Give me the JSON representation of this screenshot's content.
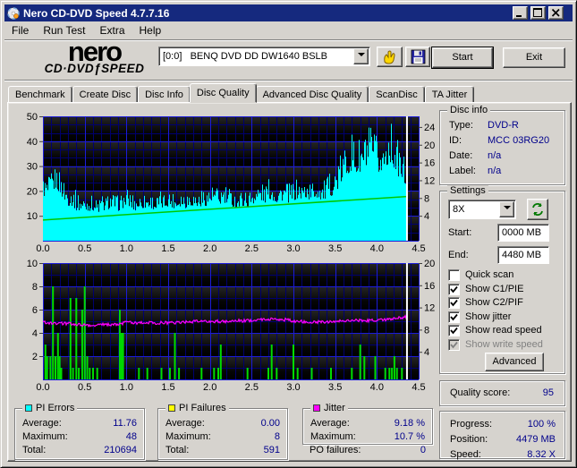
{
  "window": {
    "title": "Nero CD-DVD Speed 4.7.7.16"
  },
  "menu": {
    "items": [
      "File",
      "Run Test",
      "Extra",
      "Help"
    ]
  },
  "toolbar": {
    "logo_line1": "nero",
    "logo_line2": "CD·DVDƒSPEED",
    "drive_select": "[0:0]   BENQ DVD DD DW1640 BSLB",
    "start_label": "Start",
    "exit_label": "Exit"
  },
  "tabs": [
    {
      "label": "Benchmark",
      "active": false
    },
    {
      "label": "Create Disc",
      "active": false
    },
    {
      "label": "Disc Info",
      "active": false
    },
    {
      "label": "Disc Quality",
      "active": true
    },
    {
      "label": "Advanced Disc Quality",
      "active": false
    },
    {
      "label": "ScanDisc",
      "active": false
    },
    {
      "label": "TA Jitter",
      "active": false
    }
  ],
  "disc_info": {
    "title": "Disc info",
    "rows": [
      {
        "label": "Type:",
        "value": "DVD-R"
      },
      {
        "label": "ID:",
        "value": "MCC 03RG20"
      },
      {
        "label": "Date:",
        "value": "n/a"
      },
      {
        "label": "Label:",
        "value": "n/a"
      }
    ]
  },
  "settings": {
    "title": "Settings",
    "speed_value": "8X",
    "start_label": "Start:",
    "start_value": "0000 MB",
    "end_label": "End:",
    "end_value": "4480 MB",
    "checkboxes": [
      {
        "label": "Quick scan",
        "checked": false,
        "disabled": false
      },
      {
        "label": "Show C1/PIE",
        "checked": true,
        "disabled": false
      },
      {
        "label": "Show C2/PIF",
        "checked": true,
        "disabled": false
      },
      {
        "label": "Show jitter",
        "checked": true,
        "disabled": false
      },
      {
        "label": "Show read speed",
        "checked": true,
        "disabled": false
      },
      {
        "label": "Show write speed",
        "checked": true,
        "disabled": true
      }
    ],
    "advanced_label": "Advanced"
  },
  "quality": {
    "label": "Quality score:",
    "value": "95"
  },
  "progress": {
    "rows": [
      {
        "label": "Progress:",
        "value": "100 %"
      },
      {
        "label": "Position:",
        "value": "4479 MB"
      },
      {
        "label": "Speed:",
        "value": "8.32 X"
      }
    ]
  },
  "stats": [
    {
      "title": "PI Errors",
      "color": "#00ffff",
      "rows": [
        {
          "label": "Average:",
          "value": "11.76"
        },
        {
          "label": "Maximum:",
          "value": "48"
        },
        {
          "label": "Total:",
          "value": "210694"
        }
      ]
    },
    {
      "title": "PI Failures",
      "color": "#ffff00",
      "rows": [
        {
          "label": "Average:",
          "value": "0.00"
        },
        {
          "label": "Maximum:",
          "value": "8"
        },
        {
          "label": "Total:",
          "value": "591"
        }
      ]
    },
    {
      "title": "Jitter",
      "color": "#ff00ff",
      "rows": [
        {
          "label": "Average:",
          "value": "9.18 %"
        },
        {
          "label": "Maximum:",
          "value": "10.7 %"
        }
      ]
    }
  ],
  "po_failures": {
    "label": "PO failures:",
    "value": "0"
  },
  "chart_data": [
    {
      "type": "area",
      "name": "pi-errors-scan",
      "x_axis": {
        "min": 0,
        "max": 4.5,
        "major_step": 0.5,
        "minor_step": 0.1,
        "ticks": [
          "0.0",
          "0.5",
          "1.0",
          "1.5",
          "2.0",
          "2.5",
          "3.0",
          "3.5",
          "4.0",
          "4.5"
        ]
      },
      "y_left": {
        "min": 0,
        "max": 50,
        "ticks": [
          50,
          40,
          30,
          20,
          10
        ],
        "major_step": 10,
        "minor_per_major": 3
      },
      "y_right": {
        "min": 0,
        "max": 26.4,
        "ticks": [
          24,
          20,
          16,
          12,
          8,
          4
        ],
        "baseline_offset": 8
      },
      "data_end_x": 4.36,
      "cursor_color": "#ffffff",
      "series": [
        {
          "name": "pi_errors",
          "color": "#00ffff",
          "axis": "left",
          "sample_step": 0.05,
          "spike_bias": 1.6,
          "envelope_high": [
            26,
            25,
            28,
            30,
            28,
            25,
            22,
            22,
            20,
            19,
            18,
            19,
            18,
            17,
            19,
            18,
            20,
            19,
            18,
            19,
            21,
            20,
            18,
            19,
            19,
            20,
            19,
            18,
            20,
            19,
            21,
            20,
            19,
            21,
            20,
            21,
            20,
            20,
            21,
            21,
            22,
            23,
            21,
            23,
            22,
            21,
            20,
            20,
            21,
            20,
            22,
            23,
            24,
            23,
            25,
            24,
            23,
            24,
            24,
            23,
            24,
            25,
            24,
            25,
            24,
            25,
            25,
            24,
            26,
            28,
            30,
            34,
            38,
            43,
            44,
            40,
            42,
            44,
            46,
            45,
            42,
            40,
            45,
            49,
            44,
            40,
            36,
            32
          ],
          "envelope_low": [
            18,
            17,
            19,
            21,
            19,
            16,
            14,
            14,
            12,
            12,
            12,
            12,
            12,
            11,
            12,
            12,
            13,
            13,
            12,
            13,
            14,
            13,
            12,
            13,
            13,
            13,
            13,
            12,
            13,
            13,
            14,
            13,
            13,
            14,
            13,
            14,
            14,
            13,
            14,
            14,
            15,
            15,
            14,
            15,
            14,
            14,
            13,
            13,
            14,
            13,
            15,
            15,
            16,
            15,
            17,
            16,
            15,
            16,
            16,
            15,
            16,
            17,
            16,
            17,
            16,
            17,
            17,
            16,
            17,
            18,
            19,
            22,
            24,
            27,
            28,
            26,
            27,
            28,
            30,
            29,
            27,
            26,
            29,
            32,
            29,
            26,
            24,
            22
          ]
        },
        {
          "name": "read_speed",
          "color": "#00c800",
          "axis": "right",
          "points": [
            [
              0,
              3.05
            ],
            [
              4.36,
              8.35
            ]
          ]
        }
      ]
    },
    {
      "type": "spikes_line",
      "name": "pi-failures-jitter",
      "x_axis": {
        "min": 0,
        "max": 4.5,
        "major_step": 0.5,
        "minor_step": 0.1,
        "ticks": [
          "0.0",
          "0.5",
          "1.0",
          "1.5",
          "2.0",
          "2.5",
          "3.0",
          "3.5",
          "4.0",
          "4.5"
        ]
      },
      "y_left": {
        "min": 0,
        "max": 10,
        "ticks": [
          10,
          8,
          6,
          4,
          2
        ],
        "major_step": 2,
        "minor_per_major": 2
      },
      "y_right": {
        "min": 0,
        "max": 20,
        "ticks": [
          20,
          16,
          12,
          8,
          4
        ],
        "baseline_offset": 6
      },
      "data_end_x": 4.36,
      "cursor_color": "#ffffff",
      "series": [
        {
          "name": "pi_failures",
          "color": "#00dc00",
          "axis": "left",
          "spikes": [
            [
              0.03,
              3
            ],
            [
              0.05,
              2
            ],
            [
              0.09,
              2
            ],
            [
              0.12,
              8
            ],
            [
              0.15,
              2
            ],
            [
              0.18,
              4
            ],
            [
              0.2,
              2
            ],
            [
              0.22,
              1
            ],
            [
              0.33,
              7
            ],
            [
              0.36,
              1
            ],
            [
              0.4,
              7
            ],
            [
              0.43,
              1
            ],
            [
              0.47,
              6
            ],
            [
              0.5,
              8
            ],
            [
              0.53,
              2
            ],
            [
              0.56,
              1
            ],
            [
              0.6,
              1
            ],
            [
              0.65,
              1
            ],
            [
              0.92,
              6
            ],
            [
              0.94,
              4
            ],
            [
              0.96,
              4
            ],
            [
              1.15,
              1
            ],
            [
              1.25,
              1
            ],
            [
              1.42,
              1
            ],
            [
              1.52,
              1
            ],
            [
              1.58,
              4
            ],
            [
              1.63,
              1
            ],
            [
              1.9,
              1
            ],
            [
              2.05,
              1
            ],
            [
              2.1,
              1
            ],
            [
              2.13,
              3
            ],
            [
              2.45,
              1
            ],
            [
              2.7,
              1
            ],
            [
              2.74,
              3
            ],
            [
              2.8,
              1
            ],
            [
              3.0,
              3
            ],
            [
              3.05,
              1
            ],
            [
              3.22,
              1
            ],
            [
              3.45,
              1
            ],
            [
              3.7,
              1
            ],
            [
              3.8,
              3
            ],
            [
              3.85,
              2
            ],
            [
              3.98,
              2
            ],
            [
              4.1,
              1
            ],
            [
              4.15,
              1
            ],
            [
              4.18,
              1
            ],
            [
              4.21,
              2
            ],
            [
              4.24,
              1
            ],
            [
              4.3,
              1
            ]
          ]
        },
        {
          "name": "jitter",
          "color": "#ff00ff",
          "axis": "right",
          "noise": 0.28,
          "points": [
            [
              0,
              9.3
            ],
            [
              0.3,
              9.1
            ],
            [
              0.55,
              8.8
            ],
            [
              0.7,
              8.9
            ],
            [
              0.9,
              9.0
            ],
            [
              1.0,
              9.3
            ],
            [
              1.3,
              9.2
            ],
            [
              1.6,
              9.3
            ],
            [
              1.9,
              9.5
            ],
            [
              2.2,
              9.5
            ],
            [
              2.5,
              9.7
            ],
            [
              2.7,
              9.9
            ],
            [
              2.9,
              9.8
            ],
            [
              3.05,
              9.5
            ],
            [
              3.3,
              9.4
            ],
            [
              3.5,
              9.5
            ],
            [
              3.8,
              9.7
            ],
            [
              4.0,
              9.6
            ],
            [
              4.2,
              10.0
            ],
            [
              4.36,
              10.3
            ]
          ]
        }
      ]
    }
  ]
}
